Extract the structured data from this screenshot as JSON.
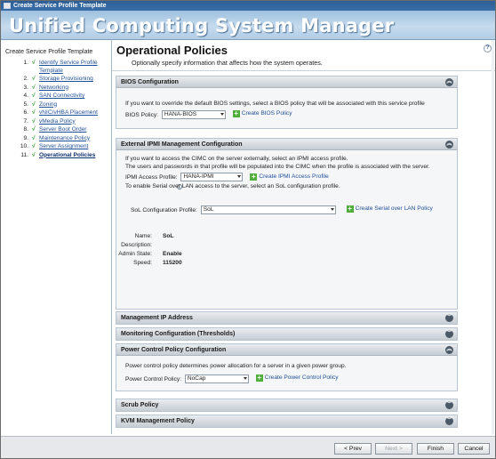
{
  "window": {
    "title": "Create Service Profile Template"
  },
  "banner": {
    "title": "Unified Computing System Manager"
  },
  "sidebar": {
    "title": "Create Service Profile Template",
    "steps": [
      {
        "num": "1.",
        "label": "Identify Service Profile Template"
      },
      {
        "num": "2.",
        "label": "Storage Provisioning"
      },
      {
        "num": "3.",
        "label": "Networking"
      },
      {
        "num": "4.",
        "label": "SAN Connectivity"
      },
      {
        "num": "5.",
        "label": "Zoning"
      },
      {
        "num": "6.",
        "label": "vNIC/vHBA Placement"
      },
      {
        "num": "7.",
        "label": "vMedia Policy"
      },
      {
        "num": "8.",
        "label": "Server Boot Order"
      },
      {
        "num": "9.",
        "label": "Maintenance Policy"
      },
      {
        "num": "10.",
        "label": "Server Assignment"
      },
      {
        "num": "11.",
        "label": "Operational Policies"
      }
    ]
  },
  "main": {
    "title": "Operational Policies",
    "subtitle": "Optionally specify information that affects how the system operates.",
    "help": "?"
  },
  "bios": {
    "header": "BIOS Configuration",
    "text": "If you want to override the default BIOS settings, select a BIOS policy that will be associated with this service profile",
    "policy_label": "BIOS Policy:",
    "policy_value": "HANA-BIOS",
    "create_link": "Create BIOS Policy"
  },
  "ipmi": {
    "header": "External IPMI Management Configuration",
    "text1": "If you want to access the CIMC on the server externally, select an IPMI access profile.",
    "text2": "The users and passwords in that profile will be populated into the CIMC when the profile is associated with the server.",
    "profile_label": "IPMI Access Profile:",
    "profile_value": "HANA-IPMI",
    "create_link": "Create IPMI Access Profile",
    "sol_text": "To enable Serial over LAN access to the server, select an SoL configuration profile.",
    "sol_label": "SoL Configuration Profile:",
    "sol_value": "SoL",
    "sol_create_link": "Create Serial over LAN Policy",
    "details": {
      "name_label": "Name:",
      "name_value": "SoL",
      "desc_label": "Description:",
      "desc_value": "",
      "admin_label": "Admin State:",
      "admin_value": "Enable",
      "speed_label": "Speed:",
      "speed_value": "115200"
    }
  },
  "mgmt_ip": {
    "header": "Management IP Address"
  },
  "monitoring": {
    "header": "Monitoring Configuration (Thresholds)"
  },
  "power": {
    "header": "Power Control Policy Configuration",
    "text": "Power control policy determines power allocation for a server in a given power group.",
    "policy_label": "Power Control Policy:",
    "policy_value": "NoCap",
    "create_link": "Create Power Control Policy"
  },
  "scrub": {
    "header": "Scrub Policy"
  },
  "kvm": {
    "header": "KVM Management Policy"
  },
  "footer": {
    "prev": "< Prev",
    "next": "Next >",
    "finish": "Finish",
    "cancel": "Cancel"
  },
  "icons": {
    "collapse": "double-chevron-up-icon",
    "expand": "double-chevron-down-icon",
    "add": "green-plus-icon",
    "info": "info-icon",
    "check": "green-check-icon"
  }
}
